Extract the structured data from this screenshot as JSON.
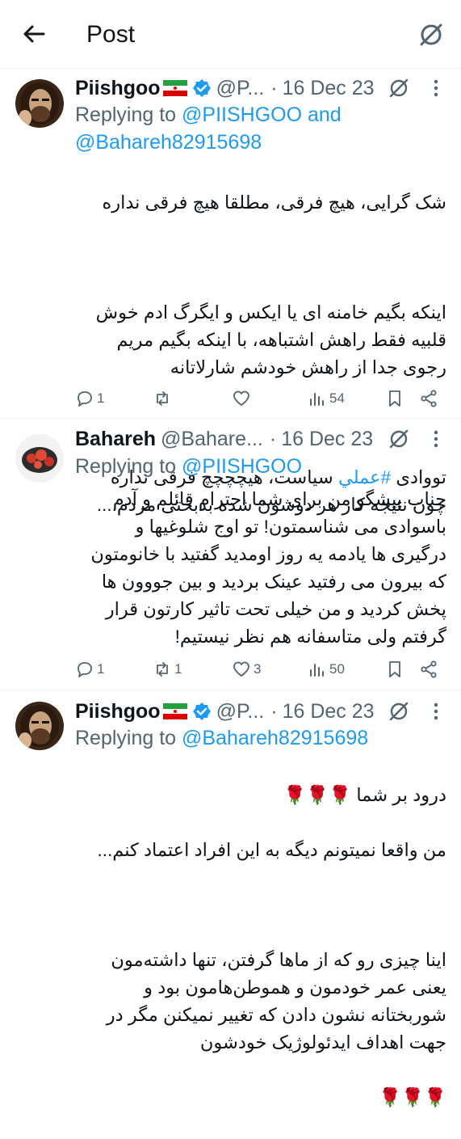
{
  "header": {
    "title": "Post"
  },
  "tweets": [
    {
      "name": "Piishgoo",
      "handle": "@P...",
      "dot": "·",
      "date": "16 Dec 23",
      "reply_prefix": "Replying to ",
      "reply_user1": "@PIISHGOO",
      "reply_and": " and",
      "reply_user2": "@Bahareh82915698",
      "line1": "شک گرایی،  هیچ فرقی، مطلقا هیچ فرقی نداره",
      "line2": "اینکه بگیم خامنه ای یا ایکس و ایگرگ ادم خوش قلبیه فقط راهش اشتباهه، با اینکه بگیم مریم رجوی جدا از راهش خودشم شارلاتانه",
      "line3_pre": "تووادی ",
      "line3_tag": "#عملي",
      "line3_post": " سیاست، هیچچچچ فرقی نداره چون نتیجه کار هر دوشون شده بدبختی مردم....",
      "stats": {
        "replies": "1",
        "reposts": "",
        "likes": "",
        "views": "54"
      }
    },
    {
      "name": "Bahareh",
      "handle": "@Bahare...",
      "dot": "·",
      "date": "16 Dec 23",
      "reply_prefix": "Replying to ",
      "reply_user1": "@PIISHGOO",
      "text": "جناب پیشگو من برای شما احترام قائلم و آدم باسوادی می شناسمتون! تو اوج شلوغیها و درگیری ها یادمه یه روز اومدید گفتید با خانومتون که بیرون می رفتید عینک بردید و بین جووون ها پخش کردید و من خیلی تحت تاثیر کارتون قرار گرفتم ولی متاسفانه هم نظر نیستیم!",
      "stats": {
        "replies": "1",
        "reposts": "1",
        "likes": "3",
        "views": "50"
      }
    },
    {
      "name": "Piishgoo",
      "handle": "@P...",
      "dot": "·",
      "date": "16 Dec 23",
      "reply_prefix": "Replying to ",
      "reply_user1": "@Bahareh82915698",
      "line1": "درود بر شما 🌹🌹🌹",
      "line2": "من واقعا نمیتونم دیگه به این افراد اعتماد کنم...",
      "line3": "اینا چیزی رو که از ماها گرفتن، تنها داشته‌مون یعنی عمر خودمون و هموطن‌هامون بود و شوربختانه نشون دادن که تغییر نمیکنن مگر در جهت اهداف ایدئولوژیک خودشون",
      "line4": "🌹🌹🌹"
    }
  ],
  "colors": {
    "link": "#1d9bf0",
    "muted": "#536471",
    "text": "#0f1419",
    "verified": "#1d9bf0"
  },
  "icons": [
    "back-arrow-icon",
    "slash-circle-icon",
    "verified-badge-icon",
    "iran-flag-icon",
    "reply-icon",
    "repost-icon",
    "like-icon",
    "views-icon",
    "bookmark-icon",
    "share-icon",
    "more-icon"
  ]
}
